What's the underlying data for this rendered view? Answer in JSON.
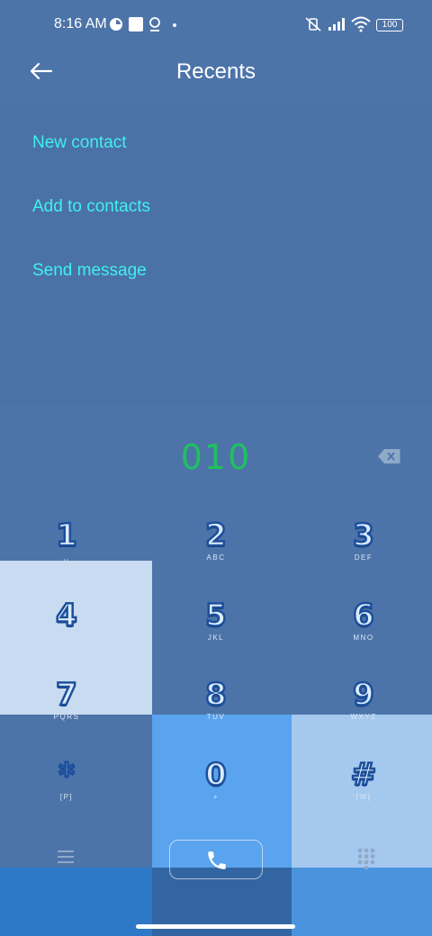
{
  "status_bar": {
    "time": "8:16 AM",
    "battery": "100"
  },
  "header": {
    "title": "Recents"
  },
  "actions": [
    {
      "label": "New contact"
    },
    {
      "label": "Add to contacts"
    },
    {
      "label": "Send message"
    }
  ],
  "dialer": {
    "number": "010"
  },
  "keypad": [
    {
      "digit": "1",
      "letters": "␣"
    },
    {
      "digit": "2",
      "letters": "ABC"
    },
    {
      "digit": "3",
      "letters": "DEF"
    },
    {
      "digit": "4",
      "letters": ""
    },
    {
      "digit": "5",
      "letters": "JKL"
    },
    {
      "digit": "6",
      "letters": "MNO"
    },
    {
      "digit": "7",
      "letters": "PQRS"
    },
    {
      "digit": "8",
      "letters": "TUV"
    },
    {
      "digit": "9",
      "letters": "WXYZ"
    },
    {
      "digit": "*",
      "letters": "[P]"
    },
    {
      "digit": "0",
      "letters": "+"
    },
    {
      "digit": "#",
      "letters": "[W]"
    }
  ],
  "colors": {
    "background": "#4d74a9",
    "action_link": "#3ff0ee",
    "dialed_number": "#1fc15e"
  },
  "icons": {
    "back": "arrow-left-icon",
    "backspace": "backspace-icon",
    "menu": "menu-icon",
    "call": "phone-icon",
    "dialpad": "dialpad-icon"
  }
}
